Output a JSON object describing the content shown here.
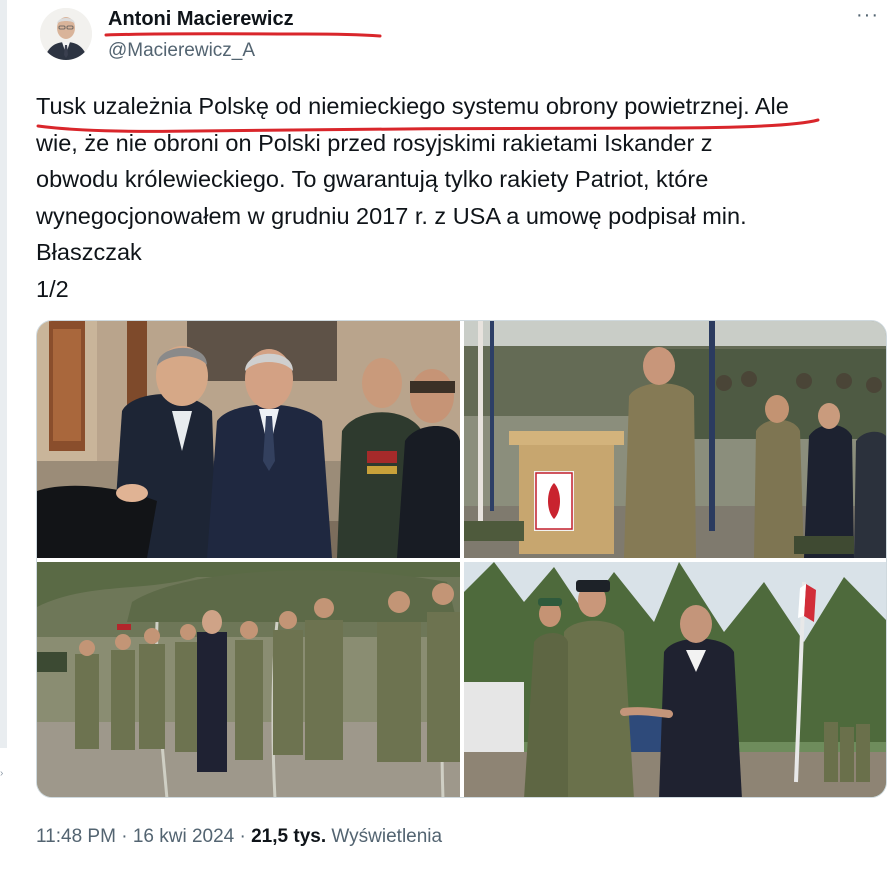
{
  "author": {
    "name": "Antoni Macierewicz",
    "handle": "@Macierewicz_A"
  },
  "more_label": "···",
  "text": {
    "highlighted": "Tusk uzależnia Polskę od niemieckiego systemu obrony powietrznej",
    "rest_first_line": ". Ale",
    "lines": [
      "wie, że nie obroni on Polski przed rosyjskimi rakietami Iskander z",
      "obwodu królewieckiego. To gwarantują tylko rakiety Patriot, które",
      "wynegocjonowałem w grudniu 2017 r. z USA a umowę podpisał min.",
      "Błaszczak",
      "1/2"
    ]
  },
  "meta": {
    "time": "11:48 PM",
    "date": "16 kwi 2024",
    "separator": " · ",
    "views_count": "21,5 tys.",
    "views_label": "Wyświetlenia"
  },
  "colors": {
    "annotation_red": "#d9262b",
    "secondary_text": "#536471",
    "primary_text": "#0f1419"
  },
  "icons": {
    "more": "more-icon",
    "left_rail_chevron": "chevron-icon"
  }
}
